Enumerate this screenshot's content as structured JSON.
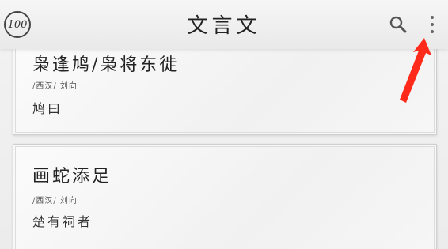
{
  "header": {
    "badge": "100",
    "title": "文言文",
    "search_icon": "search-icon",
    "more_icon": "more-vert-icon"
  },
  "colors": {
    "annotation_arrow": "#ff2a1a"
  },
  "articles": [
    {
      "title": "枭逢鸠/枭将东徙",
      "meta": "/西汉/ 刘向",
      "excerpt": "鸠曰"
    },
    {
      "title": "画蛇添足",
      "meta": "/西汉/ 刘向",
      "excerpt": "楚有祠者"
    }
  ]
}
